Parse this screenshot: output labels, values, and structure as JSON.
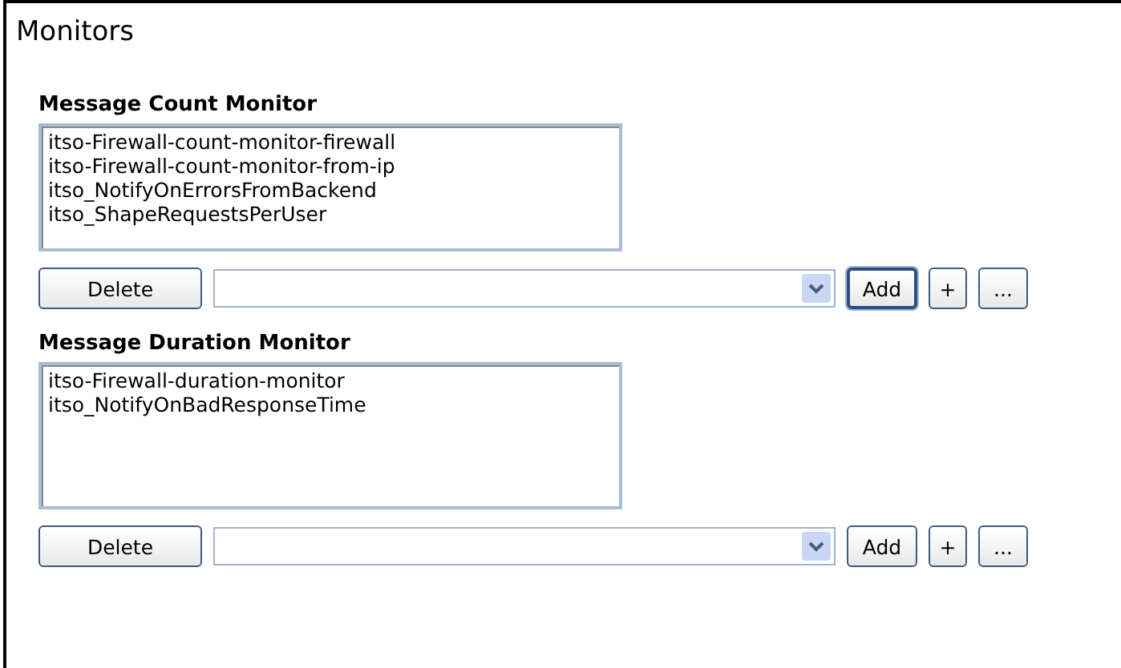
{
  "title": "Monitors",
  "sections": [
    {
      "heading": "Message Count Monitor",
      "items": [
        "itso-Firewall-count-monitor-firewall",
        "itso-Firewall-count-monitor-from-ip",
        "itso_NotifyOnErrorsFromBackend",
        "itso_ShapeRequestsPerUser"
      ],
      "delete_button": "Delete",
      "add_button": {
        "label": "Add",
        "focused": true
      },
      "plus_button": "+",
      "more_button": "..."
    },
    {
      "heading": "Message Duration Monitor",
      "items": [
        "itso-Firewall-duration-monitor",
        "itso_NotifyOnBadResponseTime"
      ],
      "delete_button": "Delete",
      "add_button": {
        "label": "Add",
        "focused": false
      },
      "plus_button": "+",
      "more_button": "..."
    }
  ]
}
